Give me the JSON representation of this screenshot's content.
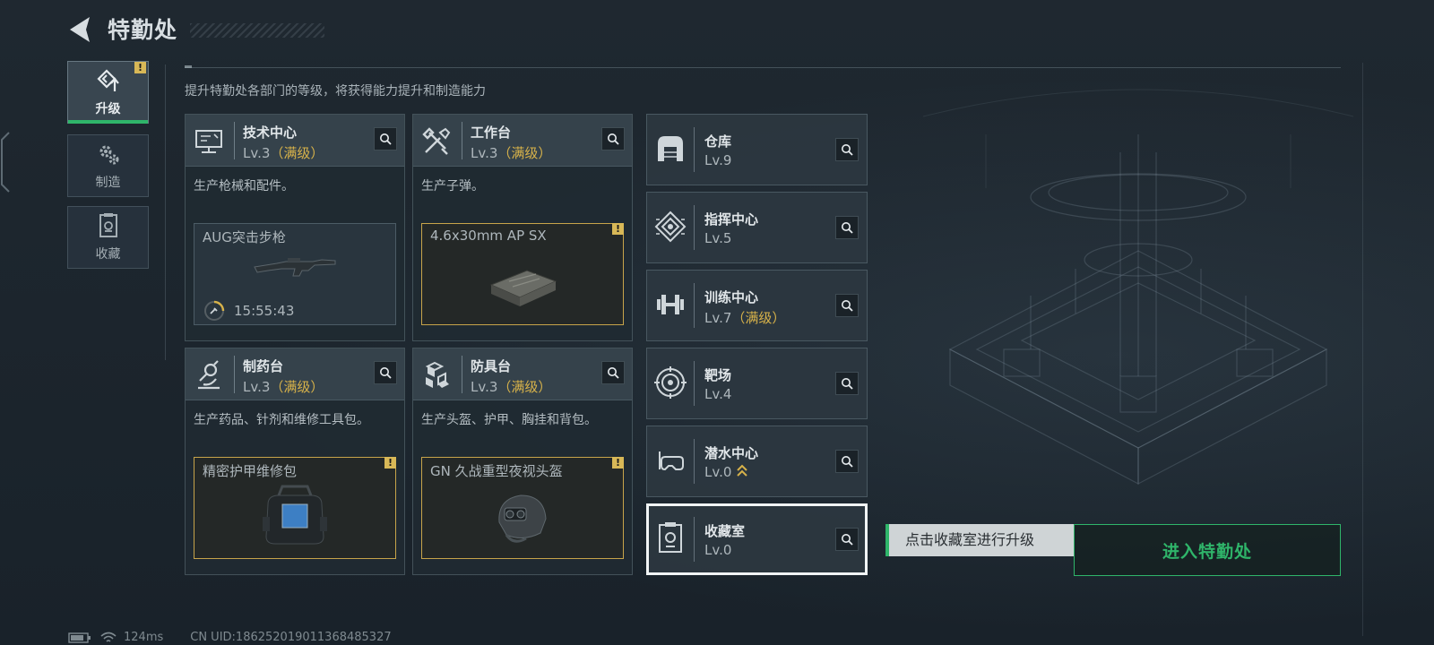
{
  "header": {
    "title": "特勤处"
  },
  "subtitle": "提升特勤处各部门的等级，将获得能力提升和制造能力",
  "sidebar": {
    "tabs": [
      {
        "label": "升级",
        "icon": "upgrade-icon",
        "active": true,
        "badge": "!"
      },
      {
        "label": "制造",
        "icon": "gear-icon",
        "active": false
      },
      {
        "label": "收藏",
        "icon": "collection-icon",
        "active": false
      }
    ]
  },
  "facilities": [
    {
      "name": "技术中心",
      "level": "Lv.3",
      "max_tag": "（满级）",
      "icon": "monitor-icon",
      "description": "生产枪械和配件。",
      "product": {
        "name": "AUG突击步枪",
        "icon": "rifle-icon",
        "timer": "15:55:43",
        "highlight": false
      }
    },
    {
      "name": "工作台",
      "level": "Lv.3",
      "max_tag": "（满级）",
      "icon": "tools-icon",
      "description": "生产子弹。",
      "product": {
        "name": "4.6x30mm AP SX",
        "icon": "ammo-box-icon",
        "highlight": true,
        "badge": "!"
      }
    },
    {
      "name": "制药台",
      "level": "Lv.3",
      "max_tag": "（满级）",
      "icon": "microscope-icon",
      "description": "生产药品、针剂和维修工具包。",
      "product": {
        "name": "精密护甲维修包",
        "icon": "repair-kit-icon",
        "highlight": true,
        "badge": "!"
      }
    },
    {
      "name": "防具台",
      "level": "Lv.3",
      "max_tag": "（满级）",
      "icon": "cubes-icon",
      "description": "生产头盔、护甲、胸挂和背包。",
      "product": {
        "name": "GN 久战重型夜视头盔",
        "icon": "helmet-icon",
        "highlight": true,
        "badge": "!"
      }
    }
  ],
  "rooms": [
    {
      "name": "仓库",
      "level": "Lv.9",
      "max_tag": "",
      "icon": "warehouse-icon"
    },
    {
      "name": "指挥中心",
      "level": "Lv.5",
      "max_tag": "",
      "icon": "command-icon"
    },
    {
      "name": "训练中心",
      "level": "Lv.7",
      "max_tag": "（满级）",
      "icon": "dumbbell-icon"
    },
    {
      "name": "靶场",
      "level": "Lv.4",
      "max_tag": "",
      "icon": "target-icon"
    },
    {
      "name": "潜水中心",
      "level": "Lv.0",
      "max_tag": "",
      "icon": "diving-mask-icon",
      "upgradable": true
    },
    {
      "name": "收藏室",
      "level": "Lv.0",
      "max_tag": "",
      "icon": "trophy-room-icon",
      "selected": true
    }
  ],
  "hint": "点击收藏室进行升级",
  "enter_button": "进入特勤处",
  "status": {
    "ping": "124ms",
    "uid": "CN UID:1862520190113684853​27"
  },
  "colors": {
    "accent_green": "#2fb56a",
    "max_gold": "#d7b24a",
    "badge_yellow": "#d8b857"
  }
}
